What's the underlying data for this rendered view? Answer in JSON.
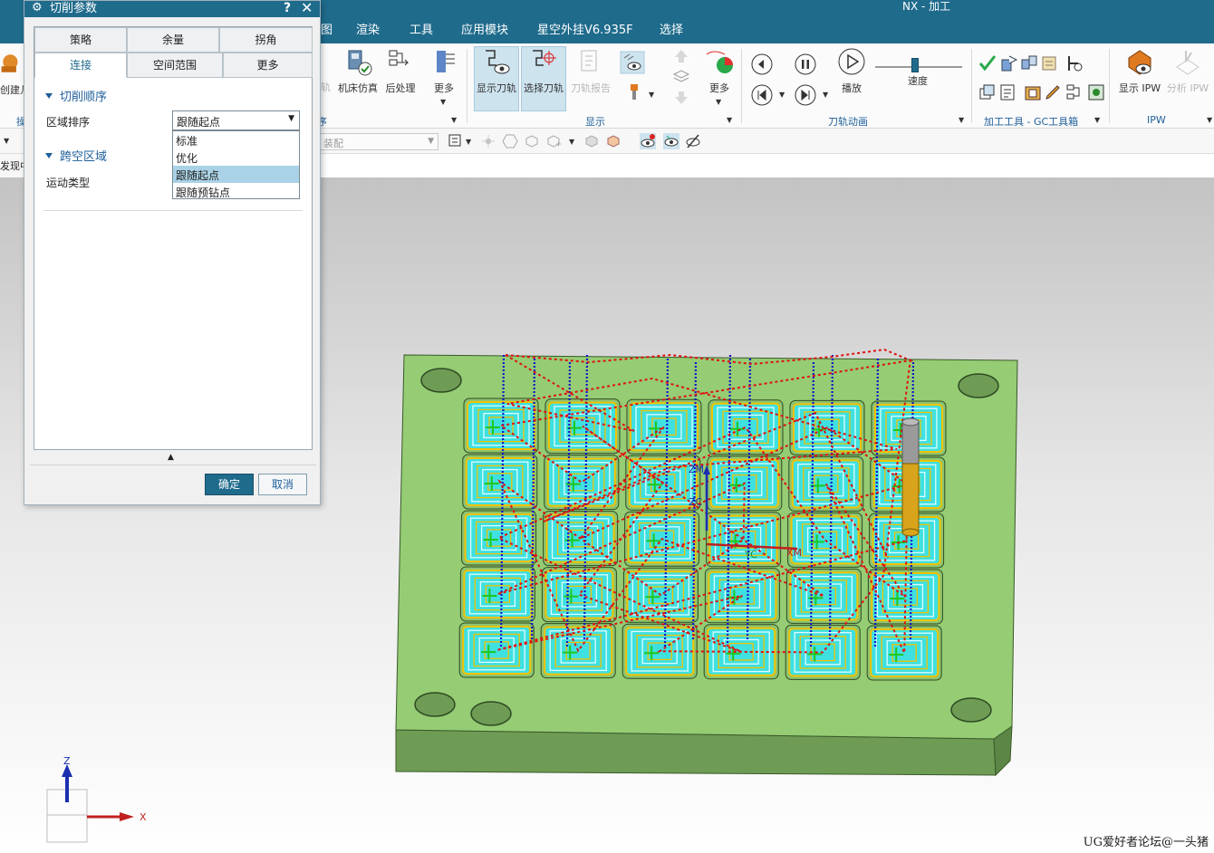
{
  "app": {
    "title": "NX - 加工"
  },
  "menubar": {
    "items": [
      "图",
      "渲染",
      "工具",
      "应用模块",
      "星空外挂V6.935F",
      "选择"
    ]
  },
  "ribbon": {
    "buttons": {
      "create": "创建几",
      "machine_sim": "机床仿真",
      "postprocess": "后处理",
      "more1": "更多",
      "show_toolpath": "显示刀轨",
      "select_toolpath": "选择刀轨",
      "toolpath_report": "刀轨报告",
      "more2": "更多",
      "play": "播放",
      "speed": "速度",
      "show_ipw": "显示 IPW",
      "analyze_ipw": "分析 IPW",
      "hidden_partial": "轨"
    },
    "groups": {
      "left_partial": "操",
      "left_partial2": "序",
      "display": "显示",
      "animation": "刀轨动画",
      "gc_toolbox": "加工工具 - GC工具箱",
      "ipw": "IPW"
    },
    "speed_level": 0.5
  },
  "toolbar": {
    "assembly_filter": "装配",
    "status_partial": "发现中"
  },
  "dialog": {
    "title": "切削参数",
    "help_icon": "?",
    "close_icon": "✕",
    "tabs_row1": [
      "策略",
      "余量",
      "拐角"
    ],
    "tabs_row2": [
      "连接",
      "空间范围",
      "更多"
    ],
    "active_tab": "连接",
    "section1": {
      "title": "切削顺序",
      "field_label": "区域排序",
      "value": "跟随起点"
    },
    "options": [
      "标准",
      "优化",
      "跟随起点",
      "跟随预钻点"
    ],
    "selected_option": "跟随起点",
    "section2": {
      "title": "跨空区域",
      "field_label": "运动类型"
    },
    "ok": "确定",
    "cancel": "取消"
  },
  "viewport": {
    "triad": {
      "z": "Z",
      "x": "X"
    },
    "wcs": {
      "zm": "ZM",
      "zc": "ZC",
      "yc": "YC",
      "xm": "XM"
    },
    "watermark": "UG爱好者论坛@一头猪"
  },
  "colors": {
    "title_bar": "#1f6b8c",
    "plate_top": "#95cc74",
    "plate_side": "#6f9c55",
    "toolpath_cyan": "#3fe0e0",
    "toolpath_yellow": "#f2c200",
    "rapid_red": "#e01010",
    "feed_blue": "#1414cc",
    "tool_gold": "#d7a41c",
    "ok_button": "#1f6b8c"
  }
}
